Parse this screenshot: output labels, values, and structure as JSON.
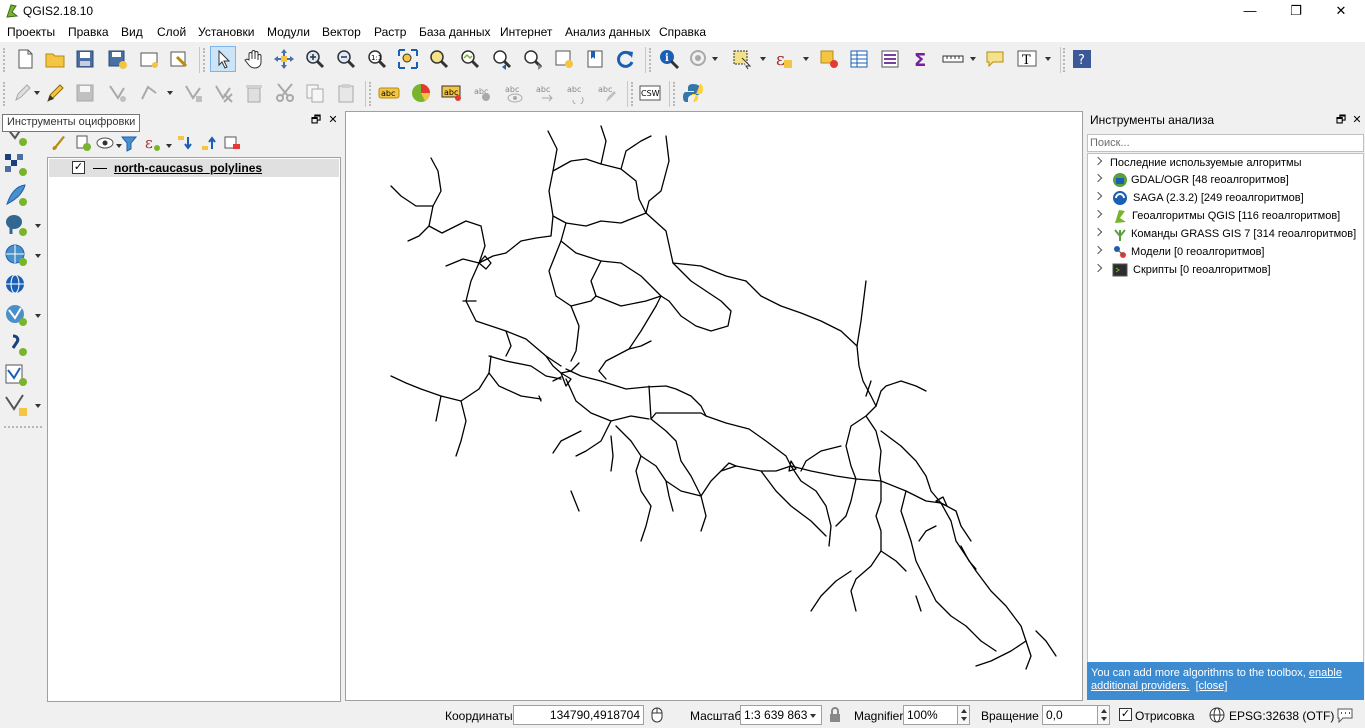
{
  "window": {
    "title": "QGIS2.18.10",
    "minimize_glyph": "—",
    "maximize_glyph": "❐",
    "close_glyph": "✕"
  },
  "menu": [
    "Проекты",
    "Правка",
    "Вид",
    "Слой",
    "Установки",
    "Модули",
    "Вектор",
    "Растр",
    "База данных",
    "Интернет",
    "Анализ данных",
    "Справка"
  ],
  "toolbars": {
    "label_tool_text": "abc",
    "csw_label": "CSW",
    "text_annotation_glyph": "T",
    "help_glyph": "?",
    "sum_glyph": "Σ",
    "expression_glyph": "ε"
  },
  "tooltip": "Инструменты оцифровки",
  "layers_panel": {
    "float_glyph": "🗗",
    "close_glyph": "✕",
    "checkbox_glyph": "✓",
    "layer_name": "north-caucasus_polylines"
  },
  "processing_panel": {
    "title": "Инструменты анализа",
    "float_glyph": "🗗",
    "close_glyph": "✕",
    "search_placeholder": "Поиск...",
    "items": [
      {
        "label": "Последние используемые алгоритмы",
        "icon": "none"
      },
      {
        "label": "GDAL/OGR [48 геоалгоритмов]",
        "icon": "gdal-icon"
      },
      {
        "label": "SAGA (2.3.2) [249 геоалгоритмов]",
        "icon": "saga-icon"
      },
      {
        "label": "Геоалгоритмы QGIS [116 геоалгоритмов]",
        "icon": "qgis-icon"
      },
      {
        "label": "Команды GRASS GIS 7 [314 геоалгоритмов]",
        "icon": "grass-icon"
      },
      {
        "label": "Модели [0 геоалгоритмов]",
        "icon": "models-icon"
      },
      {
        "label": "Скрипты [0 геоалгоритмов]",
        "icon": "scripts-icon"
      }
    ],
    "notice_text": "You can add more algorithms to the toolbox, ",
    "notice_link": "enable additional providers.",
    "notice_close": "[close]"
  },
  "statusbar": {
    "coord_label": "Координаты",
    "coord_value": "134790,4918704",
    "scale_label": "Масштаб",
    "scale_value": "1:3 639 863",
    "magnifier_label": "Magnifier",
    "magnifier_value": "100%",
    "rotation_label": "Вращение",
    "rotation_value": "0,0",
    "render_checkbox_glyph": "✓",
    "render_label": "Отрисовка",
    "crs_label": "EPSG:32638 (OTF)"
  },
  "colors": {
    "accent": "#3d8bd1",
    "map_lines": "#000000",
    "title_bar": "#ffffff"
  }
}
